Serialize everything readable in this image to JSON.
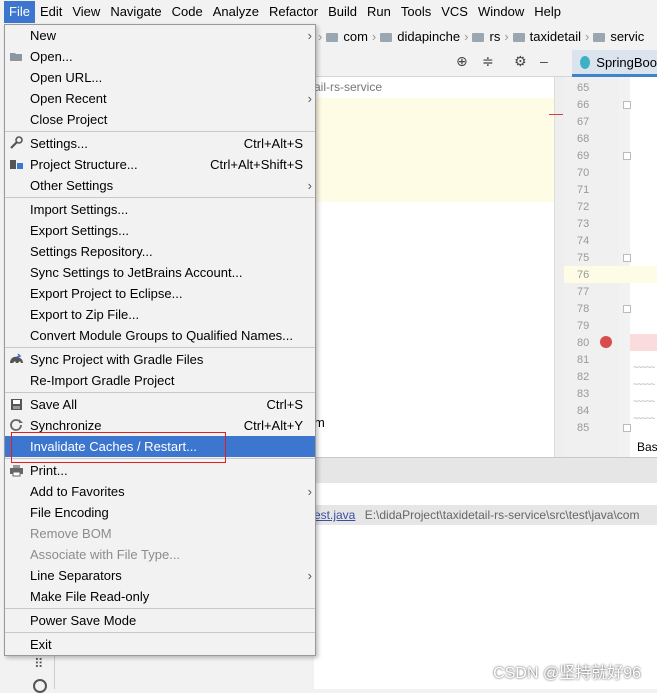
{
  "menubar": [
    "File",
    "Edit",
    "View",
    "Navigate",
    "Code",
    "Analyze",
    "Refactor",
    "Build",
    "Run",
    "Tools",
    "VCS",
    "Window",
    "Help"
  ],
  "breadcrumb": [
    "com",
    "didapinche",
    "rs",
    "taxidetail",
    "servic"
  ],
  "editor_tab": "SpringBoo",
  "project_path": "ail-rs-service",
  "line_numbers": [
    "65",
    "66",
    "67",
    "68",
    "69",
    "70",
    "71",
    "72",
    "73",
    "74",
    "75",
    "76",
    "77",
    "78",
    "79",
    "80",
    "81",
    "82",
    "83",
    "84",
    "85"
  ],
  "bas_label": "Bas",
  "run_file": "est.java",
  "run_path": "E:\\didaProject\\taxidetail-rs-service\\src\\test\\java\\com",
  "hidden_suffix": "m",
  "watermark": "CSDN @坚持就好96",
  "file_menu": {
    "new": "New",
    "open": "Open...",
    "open_url": "Open URL...",
    "open_recent": "Open Recent",
    "close_project": "Close Project",
    "settings": "Settings...",
    "settings_sc": "Ctrl+Alt+S",
    "project_structure": "Project Structure...",
    "project_structure_sc": "Ctrl+Alt+Shift+S",
    "other_settings": "Other Settings",
    "import_settings": "Import Settings...",
    "export_settings": "Export Settings...",
    "settings_repository": "Settings Repository...",
    "sync_jetbrains": "Sync Settings to JetBrains Account...",
    "export_eclipse": "Export Project to Eclipse...",
    "export_zip": "Export to Zip File...",
    "convert_module": "Convert Module Groups to Qualified Names...",
    "sync_gradle": "Sync Project with Gradle Files",
    "reimport_gradle": "Re-Import Gradle Project",
    "save_all": "Save All",
    "save_all_sc": "Ctrl+S",
    "synchronize": "Synchronize",
    "synchronize_sc": "Ctrl+Alt+Y",
    "invalidate": "Invalidate Caches / Restart...",
    "print": "Print...",
    "add_favorites": "Add to Favorites",
    "file_encoding": "File Encoding",
    "remove_bom": "Remove BOM",
    "associate": "Associate with File Type...",
    "line_separators": "Line Separators",
    "make_readonly": "Make File Read-only",
    "power_save": "Power Save Mode",
    "exit": "Exit"
  }
}
